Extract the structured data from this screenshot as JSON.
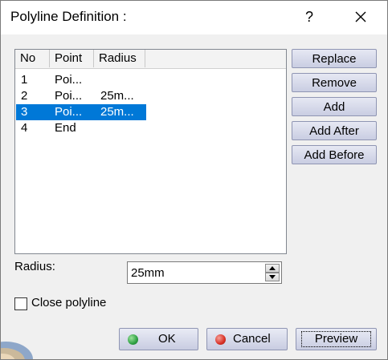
{
  "window": {
    "title": "Polyline Definition :",
    "help_label": "?"
  },
  "list": {
    "columns": [
      "No",
      "Point",
      "Radius"
    ],
    "rows": [
      {
        "no": "1",
        "point": "Poi...",
        "radius": ""
      },
      {
        "no": "2",
        "point": "Poi...",
        "radius": "25m..."
      },
      {
        "no": "3",
        "point": "Poi...",
        "radius": "25m...",
        "selected": true
      },
      {
        "no": "4",
        "point": "End",
        "radius": ""
      }
    ]
  },
  "side_buttons": {
    "replace": "Replace",
    "remove": "Remove",
    "add": "Add",
    "add_after": "Add After",
    "add_before": "Add Before"
  },
  "radius": {
    "label": "Radius:",
    "value": "25mm"
  },
  "close_polyline": {
    "label": "Close polyline",
    "checked": false
  },
  "bottom_buttons": {
    "ok": "OK",
    "cancel": "Cancel",
    "preview": "Preview"
  },
  "colors": {
    "selection": "#0078d7",
    "ok_dot": "#2ea043",
    "cancel_dot": "#d93025"
  },
  "icons": {
    "help": "question-icon",
    "close": "close-icon",
    "spin_up": "arrow-up-icon",
    "spin_down": "arrow-down-icon",
    "ok": "green-dot-icon",
    "cancel": "red-dot-icon"
  }
}
